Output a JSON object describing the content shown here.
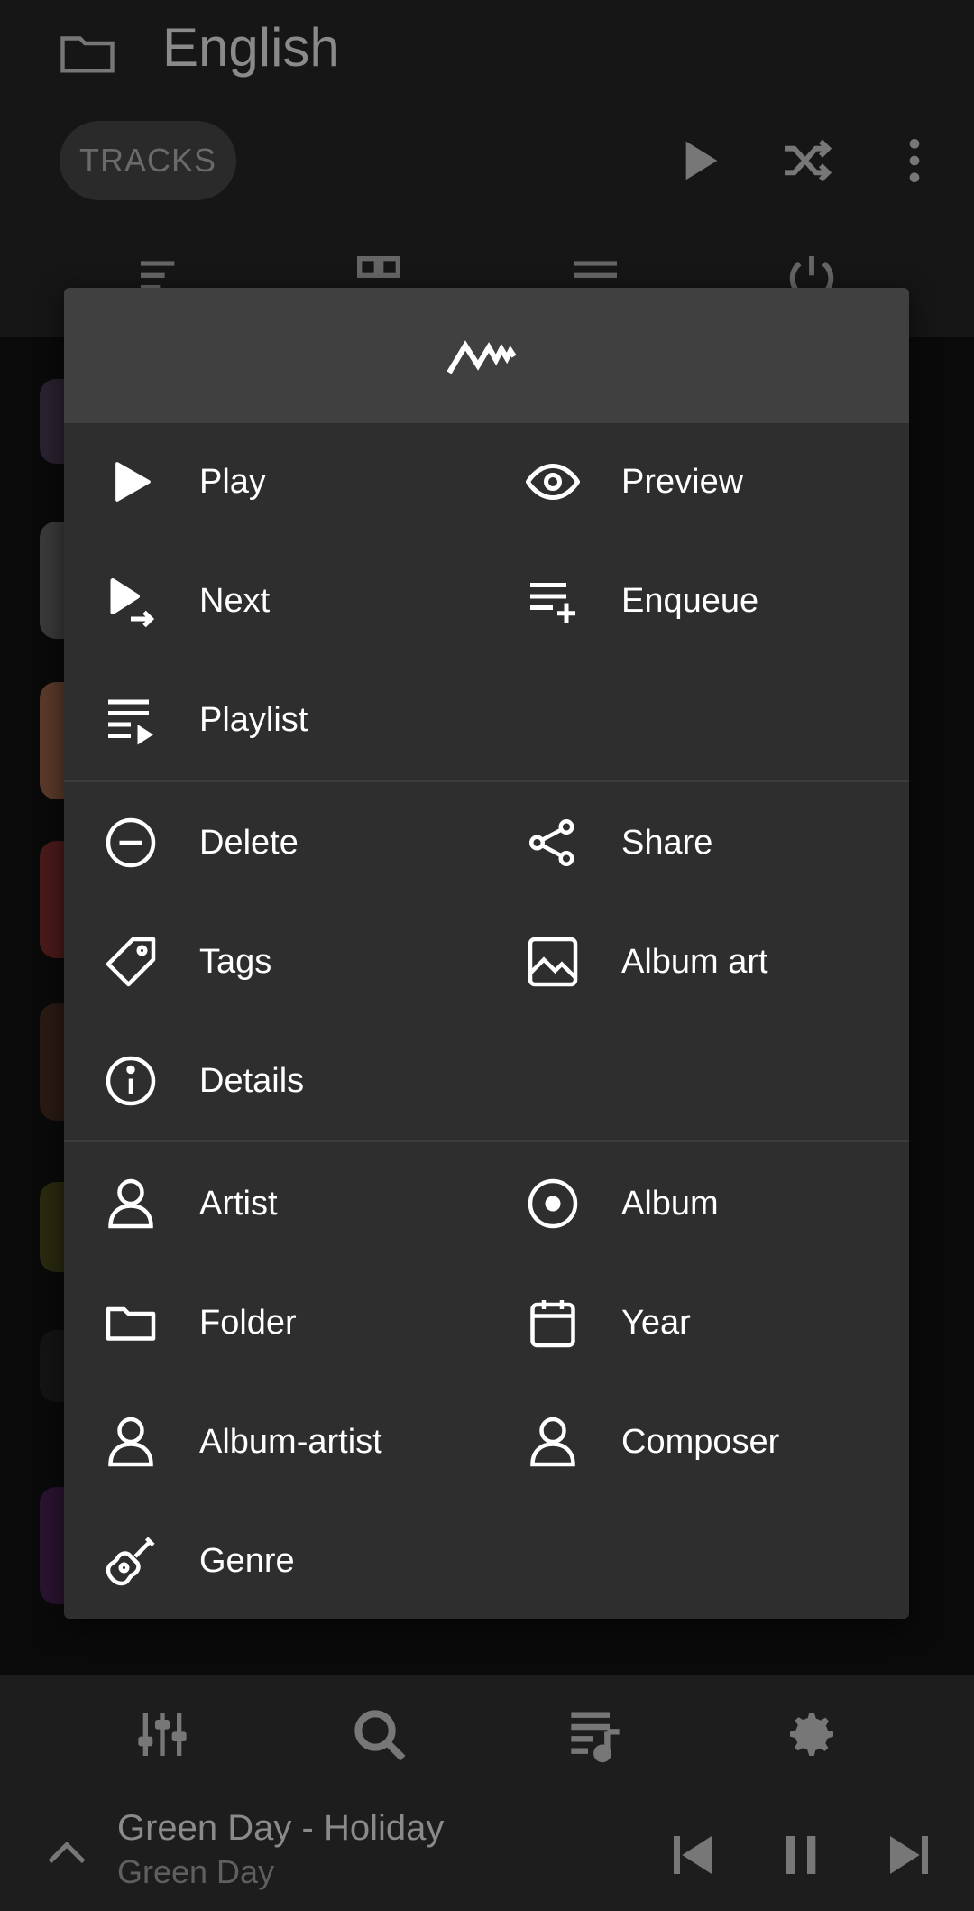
{
  "header": {
    "title": "English",
    "tab_label": "TRACKS"
  },
  "menu": {
    "items": [
      {
        "label": "Play",
        "icon": "play-icon"
      },
      {
        "label": "Preview",
        "icon": "eye-icon"
      },
      {
        "label": "Next",
        "icon": "play-next-icon"
      },
      {
        "label": "Enqueue",
        "icon": "enqueue-icon"
      },
      {
        "label": "Playlist",
        "icon": "playlist-icon"
      },
      {
        "label": "Delete",
        "icon": "minus-circle-icon"
      },
      {
        "label": "Share",
        "icon": "share-icon"
      },
      {
        "label": "Tags",
        "icon": "tag-icon"
      },
      {
        "label": "Album art",
        "icon": "image-icon"
      },
      {
        "label": "Details",
        "icon": "info-icon"
      },
      {
        "label": "Artist",
        "icon": "person-icon"
      },
      {
        "label": "Album",
        "icon": "disc-icon"
      },
      {
        "label": "Folder",
        "icon": "folder-icon"
      },
      {
        "label": "Year",
        "icon": "calendar-icon"
      },
      {
        "label": "Album-artist",
        "icon": "person-icon"
      },
      {
        "label": "Composer",
        "icon": "person-icon"
      },
      {
        "label": "Genre",
        "icon": "guitar-icon"
      }
    ]
  },
  "now_playing": {
    "title": "Green Day - Holiday",
    "artist": "Green Day"
  },
  "colors": {
    "background": "#0a0a0a",
    "dialog": "#2e2e2e",
    "dialog_header": "#404040",
    "bars": "#1d1d1d"
  }
}
